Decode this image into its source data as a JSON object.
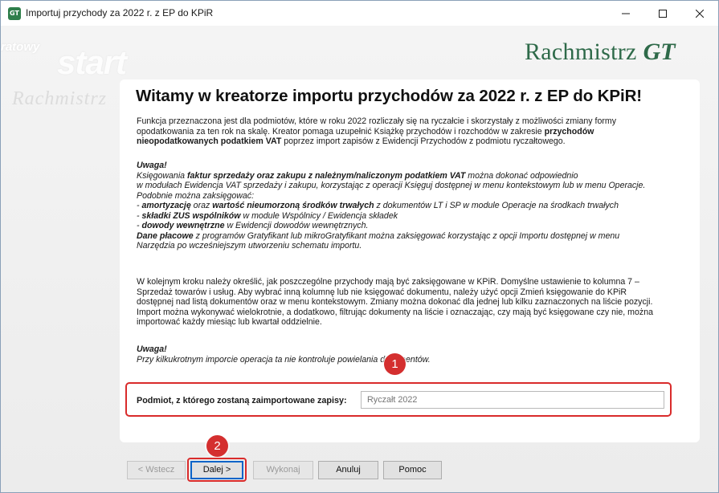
{
  "window": {
    "title": "Importuj przychody za 2022 r. z EP do KPiR",
    "app_icon_text": "GT"
  },
  "logo": {
    "name": "Rachmistrz",
    "suffix": "GT"
  },
  "watermark": {
    "small": "ratowy",
    "start": "start",
    "brand": "Rachmistrz"
  },
  "wizard": {
    "heading": "Witamy w kreatorze importu przychodów za 2022 r. z EP do KPiR!",
    "intro": {
      "line1": "Funkcja przeznaczona jest dla podmiotów, które w roku 2022 rozliczały się na ryczałcie i skorzystały z możliwości zmiany formy",
      "line2": "opodatkowania za ten rok na skalę. Kreator pomaga uzupełnić Książkę przychodów i rozchodów w zakresie ",
      "line2_bold": "przychodów",
      "line3_bold": "nieopodatkowanych podatkiem VAT",
      "line3": " poprzez import zapisów z Ewidencji Przychodów z podmiotu ryczałtowego."
    },
    "warning1": {
      "title": "Uwaga!",
      "l1_a": "Księgowania ",
      "l1_b": "faktur sprzedaży oraz zakupu z należnym/naliczonym podatkiem VAT",
      "l1_c": " można dokonać odpowiednio",
      "l2": "w modułach Ewidencja VAT sprzedaży i zakupu, korzystając z operacji Księguj dostępnej w menu kontekstowym lub w menu Operacje.",
      "l3": "Podobnie można zaksięgować:",
      "l4_a": "-   ",
      "l4_b": "amortyzację",
      "l4_c": " oraz ",
      "l4_d": "wartość nieumorzoną środków trwałych",
      "l4_e": " z dokumentów LT i SP w module Operacje na środkach trwałych",
      "l5_a": "-   ",
      "l5_b": "składki ZUS wspólników",
      "l5_c": " w module Wspólnicy / Ewidencja składek",
      "l6_a": "-   ",
      "l6_b": "dowody wewnętrzne",
      "l6_c": "  w Ewidencji dowodów wewnętrznych.",
      "l7_b": "Dane płacowe",
      "l7_c": "  z programów Gratyfikant lub mikroGratyfikant można zaksięgować korzystając z opcji  Importu dostępnej w menu",
      "l8": "Narzędzia po wcześniejszym utworzeniu schematu importu."
    },
    "info": {
      "l1": "W kolejnym kroku należy określić, jak poszczególne przychody mają być zaksięgowane w KPiR. Domyślne ustawienie to kolumna 7 –",
      "l2": "Sprzedaż towarów i usług. Aby wybrać inną kolumnę lub nie księgować dokumentu, należy użyć opcji Zmień księgowanie do KPiR",
      "l3": "dostępnej nad listą dokumentów oraz w menu kontekstowym. Zmiany można dokonać dla jednej lub kilku zaznaczonych na liście pozycji.",
      "l4": "Import można wykonywać wielokrotnie, a dodatkowo, filtrując dokumenty na liście i oznaczając, czy mają być księgowane czy nie, można",
      "l5": "importować każdy miesiąc lub kwartał oddzielnie."
    },
    "warning2": {
      "title": "Uwaga!",
      "text": "Przy kilkukrotnym imporcie operacja ta nie kontroluje powielania dokumentów."
    },
    "source_field": {
      "label": "Podmiot, z którego zostaną zaimportowane zapisy:",
      "placeholder": "Ryczałt 2022"
    }
  },
  "annotations": {
    "badge1": "1",
    "badge2": "2"
  },
  "buttons": {
    "back": "< Wstecz",
    "next": "Dalej >",
    "finish": "Wykonaj",
    "cancel": "Anuluj",
    "help": "Pomoc"
  },
  "colors": {
    "brand_green": "#2e6a49",
    "highlight_red": "#d92b2b",
    "badge_red": "#d42f2f"
  },
  "icons": [
    "app-icon",
    "minimize-icon",
    "maximize-icon",
    "close-icon"
  ]
}
